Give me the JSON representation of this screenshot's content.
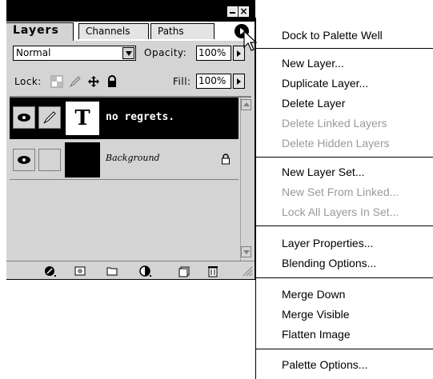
{
  "palette": {
    "tabs": {
      "layers": "Layers",
      "channels": "Channels",
      "paths": "Paths"
    },
    "blend_mode": "Normal",
    "opacity_label": "Opacity:",
    "opacity_value": "100%",
    "lock_label": "Lock:",
    "fill_label": "Fill:",
    "fill_value": "100%",
    "layers": [
      {
        "name": "no regrets.",
        "thumbnail_glyph": "T",
        "selected": true
      },
      {
        "name": "Background",
        "locked": true,
        "selected": false
      }
    ],
    "bottom_icons": [
      "layer-style-icon",
      "mask-icon",
      "new-set-icon",
      "adjustment-layer-icon",
      "new-layer-icon",
      "trash-icon"
    ]
  },
  "menu": {
    "items": [
      {
        "label": "Dock to Palette Well",
        "enabled": true
      },
      {
        "label": "New Layer...",
        "enabled": true
      },
      {
        "label": "Duplicate Layer...",
        "enabled": true
      },
      {
        "label": "Delete Layer",
        "enabled": true
      },
      {
        "label": "Delete Linked Layers",
        "enabled": false
      },
      {
        "label": "Delete Hidden Layers",
        "enabled": false
      },
      {
        "label": "New Layer Set...",
        "enabled": true
      },
      {
        "label": "New Set From Linked...",
        "enabled": false
      },
      {
        "label": "Lock All Layers In Set...",
        "enabled": false
      },
      {
        "label": "Layer Properties...",
        "enabled": true
      },
      {
        "label": "Blending Options...",
        "enabled": true
      },
      {
        "label": "Merge Down",
        "enabled": true
      },
      {
        "label": "Merge Visible",
        "enabled": true
      },
      {
        "label": "Flatten Image",
        "enabled": true
      },
      {
        "label": "Palette Options...",
        "enabled": true
      }
    ]
  }
}
